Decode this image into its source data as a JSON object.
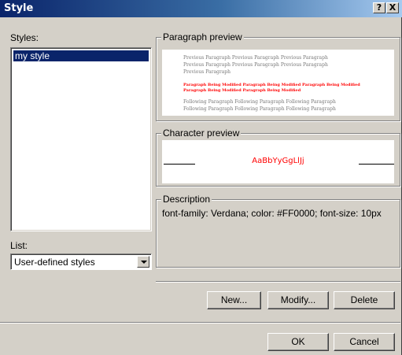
{
  "window": {
    "title": "Style",
    "help_label": "?",
    "close_label": "X"
  },
  "styles": {
    "label": "Styles:",
    "items": [
      "my style"
    ],
    "selected": "my style"
  },
  "list": {
    "label": "List:",
    "selected": "User-defined styles"
  },
  "paragraph_preview": {
    "title": "Paragraph preview",
    "previous_lines": [
      "Previous Paragraph Previous Paragraph Previous Paragraph",
      "Previous Paragraph Previous Paragraph Previous Paragraph",
      "Previous Paragraph"
    ],
    "sample_lines": [
      "Paragraph Being Modified Paragraph Being Modified Paragraph Being Modified",
      "Paragraph Being Modified Paragraph Being Modified"
    ],
    "following_lines": [
      "Following Paragraph Following Paragraph Following Paragraph",
      "Following Paragraph Following Paragraph Following Paragraph"
    ]
  },
  "character_preview": {
    "title": "Character preview",
    "sample": "AaBbYyGgLlJj",
    "color": "#FF0000"
  },
  "description": {
    "title": "Description",
    "text": "font-family: Verdana; color: #FF0000; font-size: 10px"
  },
  "buttons": {
    "new": "New...",
    "modify": "Modify...",
    "delete": "Delete",
    "ok": "OK",
    "cancel": "Cancel"
  }
}
